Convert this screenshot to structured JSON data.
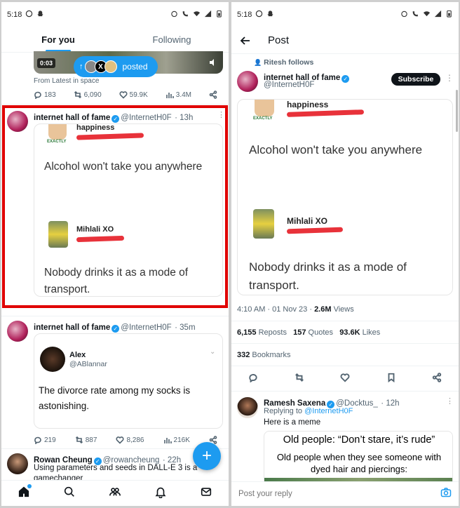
{
  "left": {
    "status": {
      "time": "5:18"
    },
    "tabs": [
      {
        "label": "For you"
      },
      {
        "label": "Following"
      }
    ],
    "top_post": {
      "video_duration": "0:03",
      "posted_pill": "posted",
      "from_space": "From Latest in space",
      "stats": {
        "replies": "183",
        "reposts": "6,090",
        "likes": "59.9K",
        "views": "3.4M"
      }
    },
    "post1": {
      "name": "internet hall of fame",
      "handle": "@InternetH0F",
      "time": "· 13h",
      "image": {
        "top_name": "happiness",
        "exactly_tag": "EXACTLY",
        "quote1": "Alcohol won't take you anywhere",
        "reply_name": "Mihlali XO",
        "quote2": "Nobody drinks it as a mode of transport."
      },
      "highlight_color": "#e00000"
    },
    "post2": {
      "name": "internet hall of fame",
      "handle": "@InternetH0F",
      "time": "· 35m",
      "quote_author": "Alex",
      "quote_handle": "@ABlannar",
      "quote_text": "The divorce rate among my socks is astonishing.",
      "stats": {
        "replies": "219",
        "reposts": "887",
        "likes": "8,286",
        "views": "216K"
      }
    },
    "post3": {
      "name": "Rowan Cheung",
      "handle": "@rowancheung",
      "time": "· 22h",
      "text": "Using parameters and seeds in DALL-E 3 is a gamechanger"
    },
    "fab": {
      "label": "+"
    }
  },
  "right": {
    "status": {
      "time": "5:18"
    },
    "header": {
      "title": "Post"
    },
    "social_context": "Ritesh follows",
    "author": {
      "name": "internet hall of fame",
      "handle": "@InternetH0F",
      "subscribe": "Subscribe"
    },
    "meta": {
      "time": "4:10 AM · 01 Nov 23 ·",
      "views_count": "2.6M",
      "views_label": "Views"
    },
    "stats": {
      "reposts_count": "6,155",
      "reposts_label": "Reposts",
      "quotes_count": "157",
      "quotes_label": "Quotes",
      "likes_count": "93.6K",
      "likes_label": "Likes",
      "bookmarks_count": "332",
      "bookmarks_label": "Bookmarks"
    },
    "reply": {
      "name": "Ramesh Saxena",
      "handle": "@Docktus_",
      "time": "· 12h",
      "replying_prefix": "Replying to",
      "replying_to": "@InternetH0F",
      "text": "Here is a meme",
      "meme_line1": "Old people: “Don’t stare, it’s rude”",
      "meme_line2": "Old people when they see someone with dyed hair and piercings:"
    },
    "reply_input": {
      "placeholder": "Post your reply"
    }
  }
}
